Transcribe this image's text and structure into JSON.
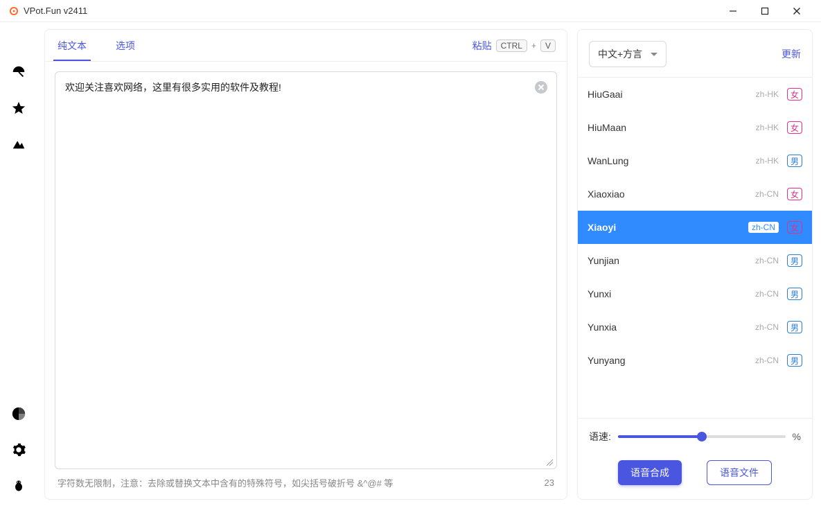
{
  "window": {
    "title": "VPot.Fun v2411"
  },
  "tabs": {
    "plain_text": "纯文本",
    "options": "选项"
  },
  "paste": {
    "label": "粘贴",
    "kbd_ctrl": "CTRL",
    "kbd_v": "V"
  },
  "text": {
    "value": "欢迎关注喜欢网络，这里有很多实用的软件及教程!"
  },
  "hint": "字符数无限制，注意：去除或替换文本中含有的特殊符号，如尖括号破折号 &^@# 等",
  "char_count": "23",
  "right": {
    "lang_selected": "中文+方言",
    "update_label": "更新",
    "speed_label": "语速:",
    "speed_pct_suffix": "%",
    "speed_pct_value": 50
  },
  "gender": {
    "female": "女",
    "male": "男"
  },
  "voices": [
    {
      "name": "HiuGaai",
      "locale": "zh-HK",
      "gender": "female",
      "selected": false
    },
    {
      "name": "HiuMaan",
      "locale": "zh-HK",
      "gender": "female",
      "selected": false
    },
    {
      "name": "WanLung",
      "locale": "zh-HK",
      "gender": "male",
      "selected": false
    },
    {
      "name": "Xiaoxiao",
      "locale": "zh-CN",
      "gender": "female",
      "selected": false
    },
    {
      "name": "Xiaoyi",
      "locale": "zh-CN",
      "gender": "female",
      "selected": true
    },
    {
      "name": "Yunjian",
      "locale": "zh-CN",
      "gender": "male",
      "selected": false
    },
    {
      "name": "Yunxi",
      "locale": "zh-CN",
      "gender": "male",
      "selected": false
    },
    {
      "name": "Yunxia",
      "locale": "zh-CN",
      "gender": "male",
      "selected": false
    },
    {
      "name": "Yunyang",
      "locale": "zh-CN",
      "gender": "male",
      "selected": false
    }
  ],
  "buttons": {
    "synthesize": "语音合成",
    "voice_file": "语音文件"
  }
}
